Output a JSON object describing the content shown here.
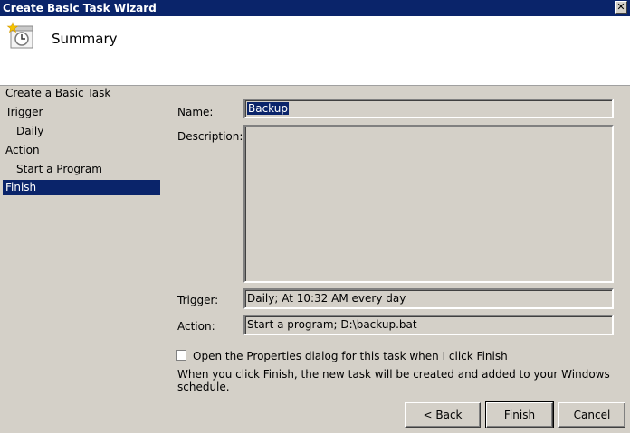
{
  "window": {
    "title": "Create Basic Task Wizard",
    "close_glyph": "✕"
  },
  "header": {
    "title": "Summary",
    "icon": "task-clock-icon"
  },
  "sidebar": {
    "items": [
      {
        "label": "Create a Basic Task"
      },
      {
        "label": "Trigger"
      },
      {
        "label": "Daily"
      },
      {
        "label": "Action"
      },
      {
        "label": "Start a Program"
      },
      {
        "label": "Finish"
      }
    ],
    "selected": "Finish"
  },
  "form": {
    "name_label": "Name:",
    "name_value": "Backup",
    "description_label": "Description:",
    "description_value": "",
    "trigger_label": "Trigger:",
    "trigger_value": "Daily; At 10:32 AM every day",
    "action_label": "Action:",
    "action_value": "Start a program; D:\\backup.bat"
  },
  "options": {
    "open_properties_label": "Open the Properties dialog for this task when I click Finish",
    "open_properties_checked": false,
    "info_text": "When you click Finish, the new task will be created and added to your Windows schedule."
  },
  "buttons": {
    "back": "< Back",
    "finish": "Finish",
    "cancel": "Cancel"
  },
  "colors": {
    "selection": "#0a246a",
    "face": "#d4d0c8"
  }
}
